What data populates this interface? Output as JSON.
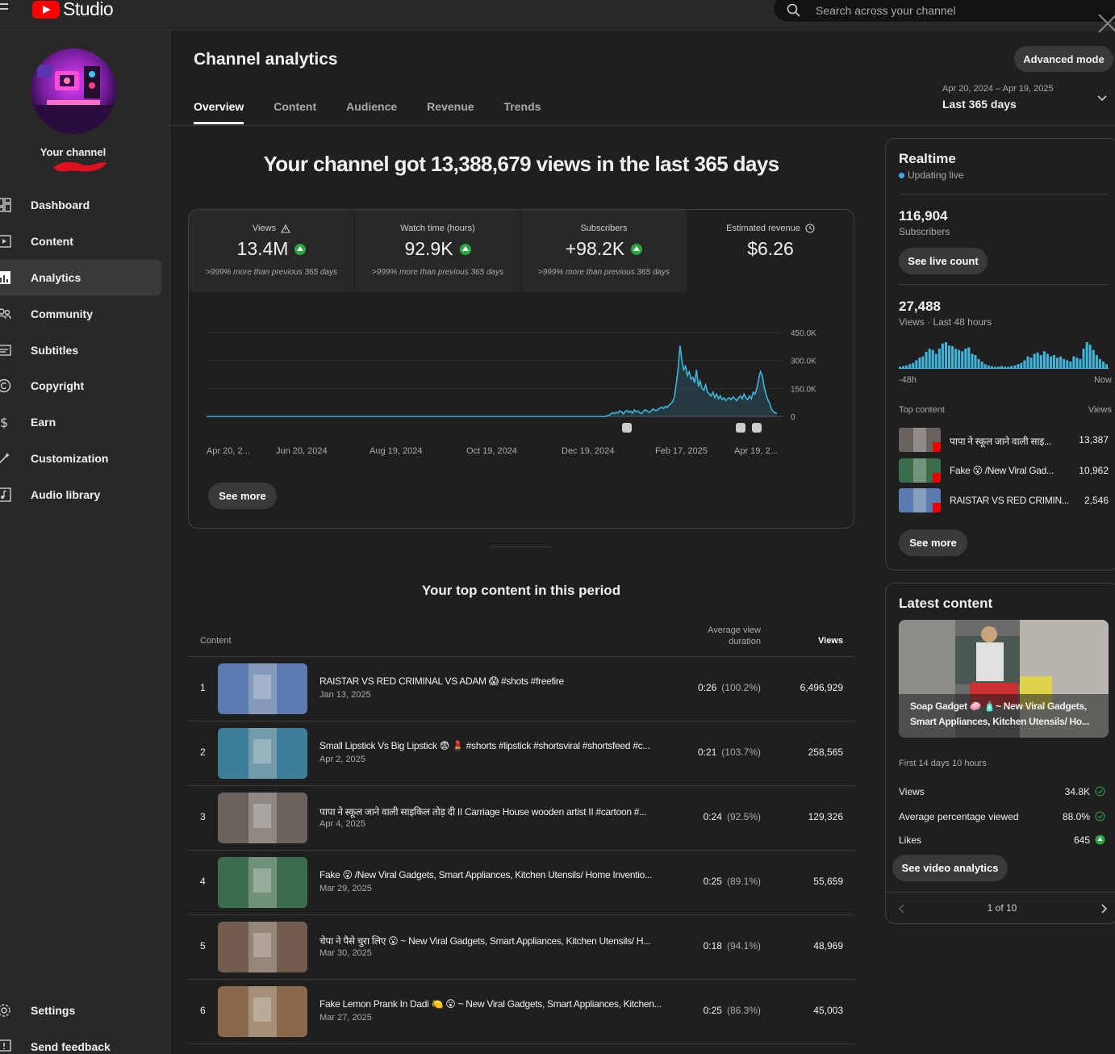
{
  "app": {
    "logo_text": "Studio"
  },
  "search": {
    "placeholder": "Search across your channel"
  },
  "sidebar": {
    "your_channel": "Your channel",
    "items": [
      {
        "label": "Dashboard",
        "icon": "dashboard-icon"
      },
      {
        "label": "Content",
        "icon": "content-icon"
      },
      {
        "label": "Analytics",
        "icon": "analytics-icon",
        "active": true
      },
      {
        "label": "Community",
        "icon": "community-icon"
      },
      {
        "label": "Subtitles",
        "icon": "subtitles-icon"
      },
      {
        "label": "Copyright",
        "icon": "copyright-icon"
      },
      {
        "label": "Earn",
        "icon": "earn-icon"
      },
      {
        "label": "Customization",
        "icon": "customization-icon"
      },
      {
        "label": "Audio library",
        "icon": "audio-library-icon"
      }
    ],
    "bottom": [
      {
        "label": "Settings",
        "icon": "settings-icon"
      },
      {
        "label": "Send feedback",
        "icon": "feedback-icon"
      }
    ]
  },
  "header": {
    "title": "Channel analytics",
    "tabs": [
      "Overview",
      "Content",
      "Audience",
      "Revenue",
      "Trends"
    ],
    "active_tab": "Overview",
    "advanced_mode": "Advanced mode",
    "date_range": "Apr 20, 2024 – Apr 19, 2025",
    "date_label": "Last 365 days"
  },
  "headline": "Your channel got 13,388,679 views in the last 365 days",
  "metrics": [
    {
      "label": "Views",
      "value": "13.4M",
      "sub": ">999% more than previous 365 days",
      "up": true,
      "warn": true
    },
    {
      "label": "Watch time (hours)",
      "value": "92.9K",
      "sub": ">999% more than previous 365 days",
      "up": true
    },
    {
      "label": "Subscribers",
      "value": "+98.2K",
      "sub": ">999% more than previous 365 days",
      "up": true
    },
    {
      "label": "Estimated revenue",
      "value": "$6.26",
      "sub": "",
      "up": false,
      "clock": true
    }
  ],
  "chart_data": {
    "type": "area",
    "series_color": "#41b4d9",
    "x_ticks": [
      "Apr 20, 2...",
      "Jun 20, 2024",
      "Aug 19, 2024",
      "Oct 19, 2024",
      "Dec 19, 2024",
      "Feb 17, 2025",
      "Apr 19, 2..."
    ],
    "y_ticks": [
      "450.0K",
      "300.0K",
      "150.0K",
      "0"
    ],
    "ylim": [
      0,
      450000
    ],
    "values": [
      0,
      0,
      0,
      0,
      0,
      0,
      0,
      0,
      0,
      0,
      0,
      0,
      0,
      0,
      0,
      0,
      0,
      0,
      0,
      0,
      0,
      0,
      0,
      0,
      0,
      0,
      0,
      0,
      0,
      0,
      0,
      0,
      0,
      0,
      0,
      0,
      0,
      0,
      0,
      0,
      0,
      0,
      0,
      0,
      0,
      0,
      0,
      0,
      0,
      0,
      0,
      0,
      0,
      0,
      0,
      0,
      0,
      0,
      0,
      0,
      0,
      0,
      0,
      0,
      0,
      0,
      0,
      0,
      0,
      0,
      0,
      0,
      0,
      0,
      0,
      0,
      0,
      0,
      0,
      0,
      0,
      0,
      0,
      0,
      0,
      0,
      0,
      0,
      0,
      0,
      0,
      0,
      0,
      0,
      0,
      0,
      0,
      0,
      0,
      0,
      0,
      0,
      0,
      0,
      0,
      0,
      0,
      0,
      0,
      0,
      0,
      0,
      0,
      0,
      0,
      0,
      0,
      0,
      0,
      0,
      0,
      0,
      0,
      0,
      0,
      0,
      0,
      0,
      0,
      0,
      0,
      0,
      0,
      0,
      0,
      0,
      0,
      0,
      0,
      0,
      0,
      0,
      0,
      0,
      0,
      0,
      0,
      0,
      0,
      0,
      0,
      0,
      0,
      0,
      0,
      0,
      0,
      0,
      0,
      0,
      0,
      0,
      0,
      0,
      0,
      0,
      0,
      0,
      0,
      0,
      0,
      0,
      0,
      0,
      0,
      0,
      0,
      0,
      0,
      0,
      0,
      0,
      0,
      0,
      0,
      0,
      0,
      0,
      0,
      0,
      0,
      0,
      0,
      0,
      0,
      0,
      0,
      0,
      0,
      0,
      0,
      0,
      0,
      0,
      0,
      0,
      0,
      0,
      0,
      0,
      0,
      0,
      0,
      0,
      0,
      0,
      0,
      0,
      0,
      3000,
      6000,
      12000,
      20000,
      15000,
      22000,
      18000,
      30000,
      25000,
      14000,
      26000,
      32000,
      22000,
      28000,
      18000,
      35000,
      24000,
      30000,
      20000,
      16000,
      28000,
      36000,
      30000,
      22000,
      26000,
      40000,
      34000,
      30000,
      38000,
      45000,
      50000,
      42000,
      55000,
      48000,
      60000,
      70000,
      80000,
      110000,
      180000,
      260000,
      380000,
      300000,
      250000,
      270000,
      220000,
      240000,
      200000,
      210000,
      180000,
      250000,
      160000,
      190000,
      150000,
      140000,
      170000,
      130000,
      120000,
      110000,
      130000,
      100000,
      120000,
      95000,
      110000,
      90000,
      100000,
      85000,
      95000,
      100000,
      90000,
      105000,
      95000,
      85000,
      100000,
      110000,
      95000,
      120000,
      100000,
      90000,
      110000,
      95000,
      130000,
      120000,
      150000,
      200000,
      240000,
      220000,
      160000,
      120000,
      90000,
      70000,
      40000,
      25000,
      20000,
      15000
    ],
    "annotations": [
      "video-marker",
      "video-marker",
      "video-marker"
    ]
  },
  "see_more": "See more",
  "top_content": {
    "title": "Your top content in this period",
    "col_content": "Content",
    "col_avd": "Average view duration",
    "col_views": "Views",
    "rows": [
      {
        "num": "1",
        "title": "RAISTAR VS RED CRIMINAL VS ADAM 😱 #shots #freefire",
        "date": "Jan 13, 2025",
        "avd": "0:26",
        "pct": "(100.2%)",
        "views": "6,496,929",
        "thumb": "#5a7bb0"
      },
      {
        "num": "2",
        "title": "Small Lipstick Vs Big Lipstick 😨 💄 #shorts #lipstick #shortsviral #shortsfeed #c...",
        "date": "Apr 2, 2025",
        "avd": "0:21",
        "pct": "(103.7%)",
        "views": "258,565",
        "thumb": "#3d7d97"
      },
      {
        "num": "3",
        "title": "पापा ने स्कूल जाने वाली साइकिल तोड़ दी II Carriage House wooden artist II #cartoon #...",
        "date": "Apr 4, 2025",
        "avd": "0:24",
        "pct": "(92.5%)",
        "views": "129,326",
        "thumb": "#6a625c"
      },
      {
        "num": "4",
        "title": "Fake 😮 /New Viral Gadgets, Smart Appliances, Kitchen Utensils/ Home Inventio...",
        "date": "Mar 29, 2025",
        "avd": "0:25",
        "pct": "(89.1%)",
        "views": "55,659",
        "thumb": "#3c6e4e"
      },
      {
        "num": "5",
        "title": "चेपा ने पैसे चुरा लिए 😮 ~ New Viral Gadgets, Smart Appliances, Kitchen Utensils/ H...",
        "date": "Mar 30, 2025",
        "avd": "0:18",
        "pct": "(94.1%)",
        "views": "48,969",
        "thumb": "#735c4f"
      },
      {
        "num": "6",
        "title": "Fake Lemon Prank In Dadi 🍋 😮 ~ New Viral Gadgets, Smart Appliances, Kitchen...",
        "date": "Mar 27, 2025",
        "avd": "0:25",
        "pct": "(86.3%)",
        "views": "45,003",
        "thumb": "#8a6a4a"
      }
    ]
  },
  "realtime": {
    "title": "Realtime",
    "status": "Updating live",
    "subs_value": "116,904",
    "subs_label": "Subscribers",
    "live_count_btn": "See live count",
    "views_value": "27,488",
    "views_label": "Views · Last 48 hours",
    "axis_left": "-48h",
    "axis_right": "Now",
    "bars": [
      2,
      3,
      4,
      6,
      8,
      12,
      16,
      18,
      25,
      30,
      28,
      22,
      30,
      38,
      40,
      35,
      34,
      30,
      28,
      26,
      30,
      32,
      22,
      20,
      14,
      10,
      6,
      4,
      3,
      2,
      2,
      3,
      2,
      2,
      3,
      4,
      6,
      8,
      12,
      18,
      16,
      22,
      24,
      20,
      26,
      22,
      18,
      20,
      16,
      18,
      14,
      12,
      10,
      18,
      16,
      14,
      30,
      40,
      36,
      28,
      20,
      14,
      10,
      6
    ],
    "top_content_label": "Top content",
    "views_col": "Views",
    "items": [
      {
        "title": "पापा ने स्कूल जाने वाली साइ...",
        "views": "13,387",
        "thumb": "#6a625c"
      },
      {
        "title": "Fake 😮 /New Viral Gad...",
        "views": "10,962",
        "thumb": "#3c6e4e"
      },
      {
        "title": "RAISTAR VS RED CRIMIN...",
        "views": "2,546",
        "thumb": "#5a7bb0"
      }
    ],
    "see_more": "See more"
  },
  "latest": {
    "title": "Latest content",
    "caption": "Soap Gadget 🧼 🧴~ New Viral Gadgets, Smart Appliances, Kitchen Utensils/ Ho...",
    "period": "First 14 days 10 hours",
    "stats": [
      {
        "label": "Views",
        "value": "34.8K",
        "state": "neutral"
      },
      {
        "label": "Average percentage viewed",
        "value": "88.0%",
        "state": "neutral"
      },
      {
        "label": "Likes",
        "value": "645",
        "state": "up"
      }
    ],
    "video_btn": "See video analytics",
    "pager": "1 of 10"
  }
}
